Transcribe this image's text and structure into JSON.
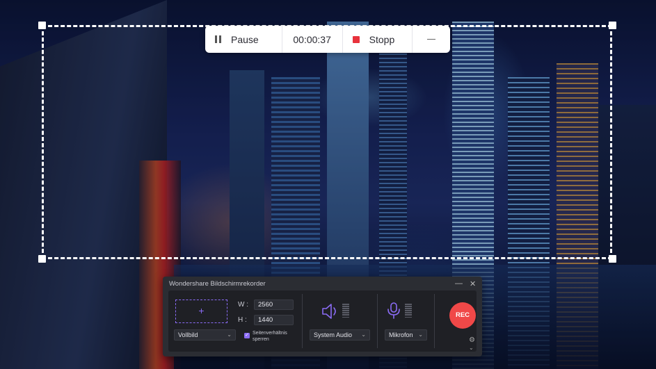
{
  "recording_toolbar": {
    "pause_label": "Pause",
    "timer": "00:00:37",
    "stop_label": "Stopp",
    "minimize_icon": "minimize-icon"
  },
  "recorder_panel": {
    "title": "Wondershare Bildschirmrekorder",
    "minimize_glyph": "—",
    "close_glyph": "✕",
    "area_plus": "+",
    "mode_select": "Vollbild",
    "width_label": "W :",
    "width_value": "2560",
    "height_label": "H :",
    "height_value": "1440",
    "aspect_lock_label": "Seitenverhältnis sperren",
    "aspect_lock_checked": true,
    "system_audio_select": "System Audio",
    "microphone_select": "Mikrofon",
    "rec_label": "REC",
    "chevron": "⌄",
    "gear_glyph": "⚙",
    "check_glyph": "✓"
  },
  "colors": {
    "accent": "#8b6cf6",
    "rec": "#f04848",
    "stop": "#e8323c"
  }
}
